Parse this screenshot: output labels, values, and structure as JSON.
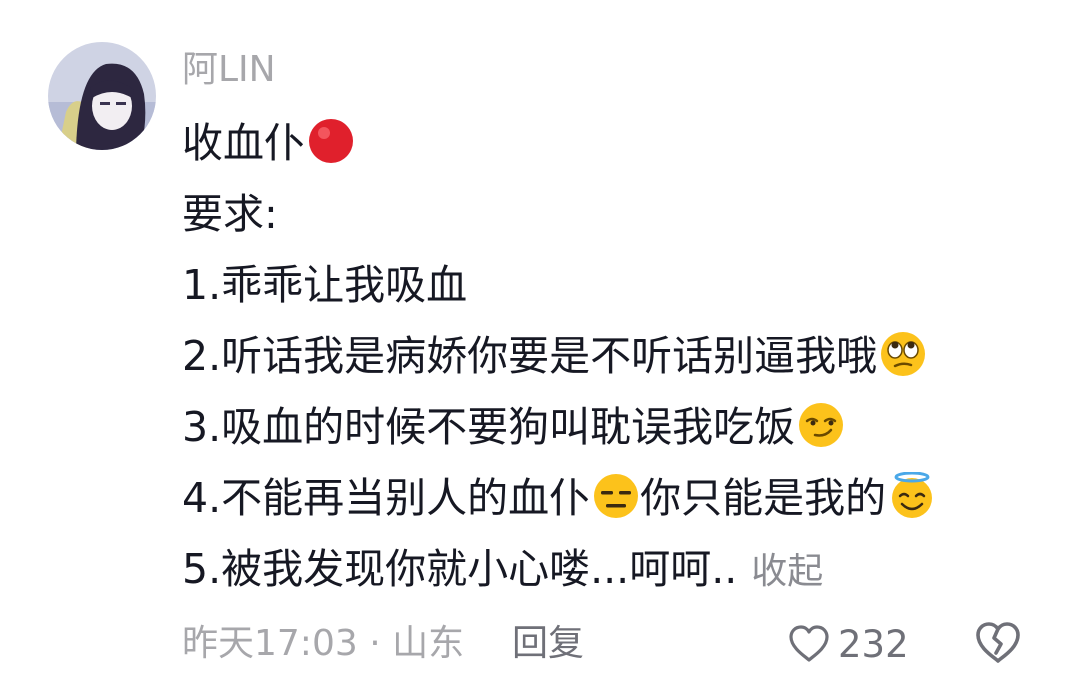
{
  "comment": {
    "username": "阿LIN",
    "lines": [
      {
        "text": "收血仆",
        "emoji": "red-circle"
      },
      {
        "text": "要求:",
        "emoji": ""
      },
      {
        "text": "1.乖乖让我吸血",
        "emoji": ""
      },
      {
        "text": "2.听话我是病娇你要是不听话别逼我哦",
        "emoji": "eye-roll-emoji"
      },
      {
        "text": "3.吸血的时候不要狗叫耽误我吃饭",
        "emoji": "smirk-emoji"
      },
      {
        "text": "4.不能再当别人的血仆",
        "mid_emoji": "expressionless-emoji",
        "text_after": "你只能是我的",
        "emoji": "halo-emoji"
      },
      {
        "text": "5.被我发现你就小心喽...呵呵..",
        "emoji": ""
      }
    ],
    "collapse_label": "收起",
    "time_location": "昨天17:03 · 山东",
    "reply_label": "回复",
    "like_count": "232",
    "colors": {
      "text": "#161823",
      "secondary": "#a7a7ab",
      "action": "#6f7078",
      "red_circle": "#e0202c"
    }
  }
}
